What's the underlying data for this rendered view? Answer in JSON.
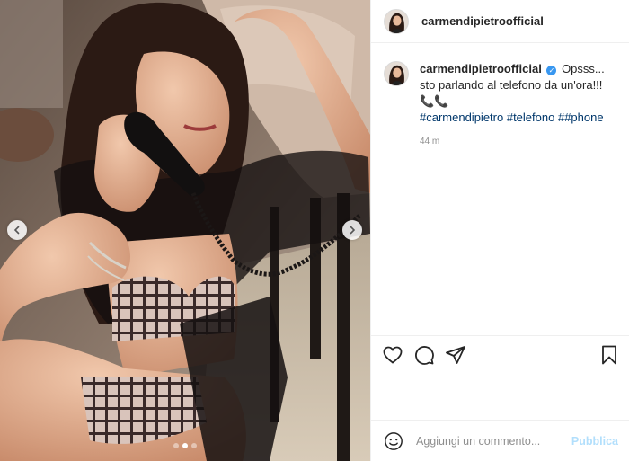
{
  "post": {
    "username": "carmendipietroofficial",
    "verified": true,
    "caption": {
      "text": "Opsss... sto parlando al telefono da un'ora!!!",
      "emoji": "📞📞",
      "hashtags": [
        "#carmendipietro",
        "#telefono",
        "##phone"
      ]
    },
    "time_ago": "44 m"
  },
  "media": {
    "carousel_count": 3,
    "active_index": 1,
    "prev_icon": "chevron-left-icon",
    "next_icon": "chevron-right-icon"
  },
  "actions": {
    "like_icon": "heart-icon",
    "comment_icon": "comment-icon",
    "share_icon": "paper-plane-icon",
    "save_icon": "bookmark-icon"
  },
  "comment_box": {
    "placeholder": "Aggiungi un commento...",
    "publish_label": "Pubblica",
    "publish_color": "#b2dffc"
  },
  "colors": {
    "text": "#262626",
    "hashtag": "#00376b",
    "muted": "#8e8e8e",
    "verified": "#3897f0"
  }
}
